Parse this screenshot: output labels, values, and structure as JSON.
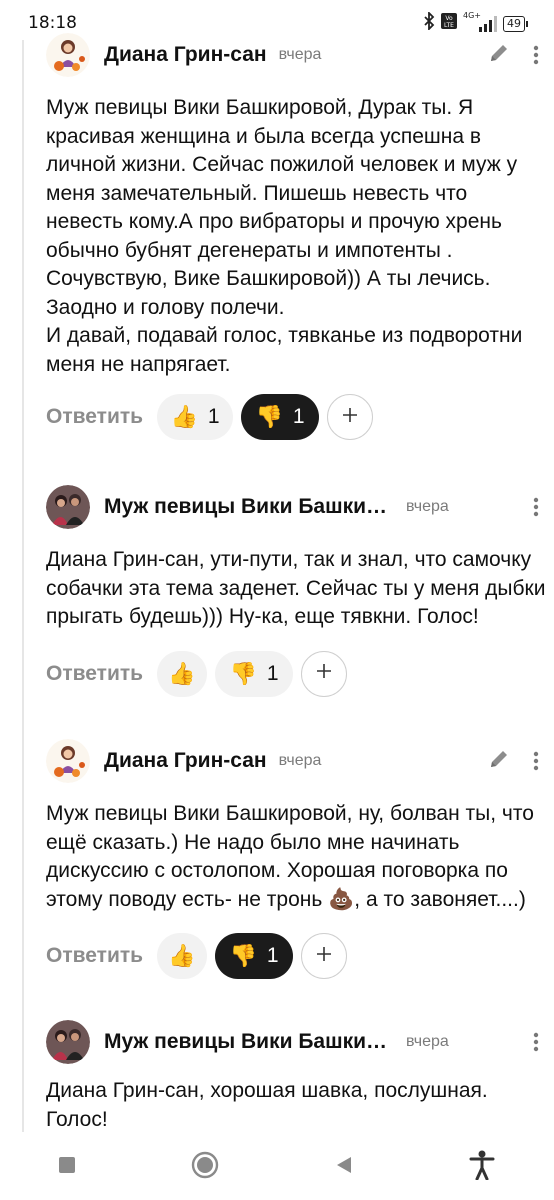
{
  "status_bar": {
    "time": "18:18",
    "network": "4G+",
    "battery": "49"
  },
  "comments": [
    {
      "author": "Диана Грин-сан",
      "time": "вчера",
      "text": "Муж певицы Вики Башкировой, Дурак ты. Я красивая женщина и была всегда успешна в личной жизни. Сейчас пожилой человек и муж у меня замечательный. Пишешь невесть что невесть кому.А про вибраторы и прочую хрень обычно бубнят дегенераты и импотенты .\nСочувствую, Вике Башкировой)) А ты лечись. Заодно и голову полечи.\nИ давай, подавай голос, тявканье из подворотни меня не напрягает.",
      "reply_label": "Ответить",
      "likes": "1",
      "dislikes": "1"
    },
    {
      "author": "Муж певицы Вики Башкировой",
      "time": "вчера",
      "text": "Диана Грин-сан, ути-пути, так и знал, что самочку собачки эта тема заденет. Сейчас ты у меня дыбки прыгать будешь))) Ну-ка, еще тявкни. Голос!",
      "reply_label": "Ответить",
      "likes": "",
      "dislikes": "1"
    },
    {
      "author": "Диана Грин-сан",
      "time": "вчера",
      "text": "Муж певицы Вики Башкировой, ну, болван ты, что ещё сказать.) Не надо было мне начинать дискуссию с остолопом. Хорошая поговорка по этому поводу есть- не тронь 💩, а то завоняет....)",
      "reply_label": "Ответить",
      "likes": "",
      "dislikes": "1"
    },
    {
      "author": "Муж певицы Вики Башкировой",
      "time": "вчера",
      "text": "Диана Грин-сан, хорошая шавка, послушная. Голос!"
    }
  ],
  "icons": {
    "edit": "pencil-icon",
    "more": "more-vertical-icon",
    "like": "thumbs-up-icon",
    "dislike": "thumbs-down-icon",
    "add": "plus-icon"
  }
}
